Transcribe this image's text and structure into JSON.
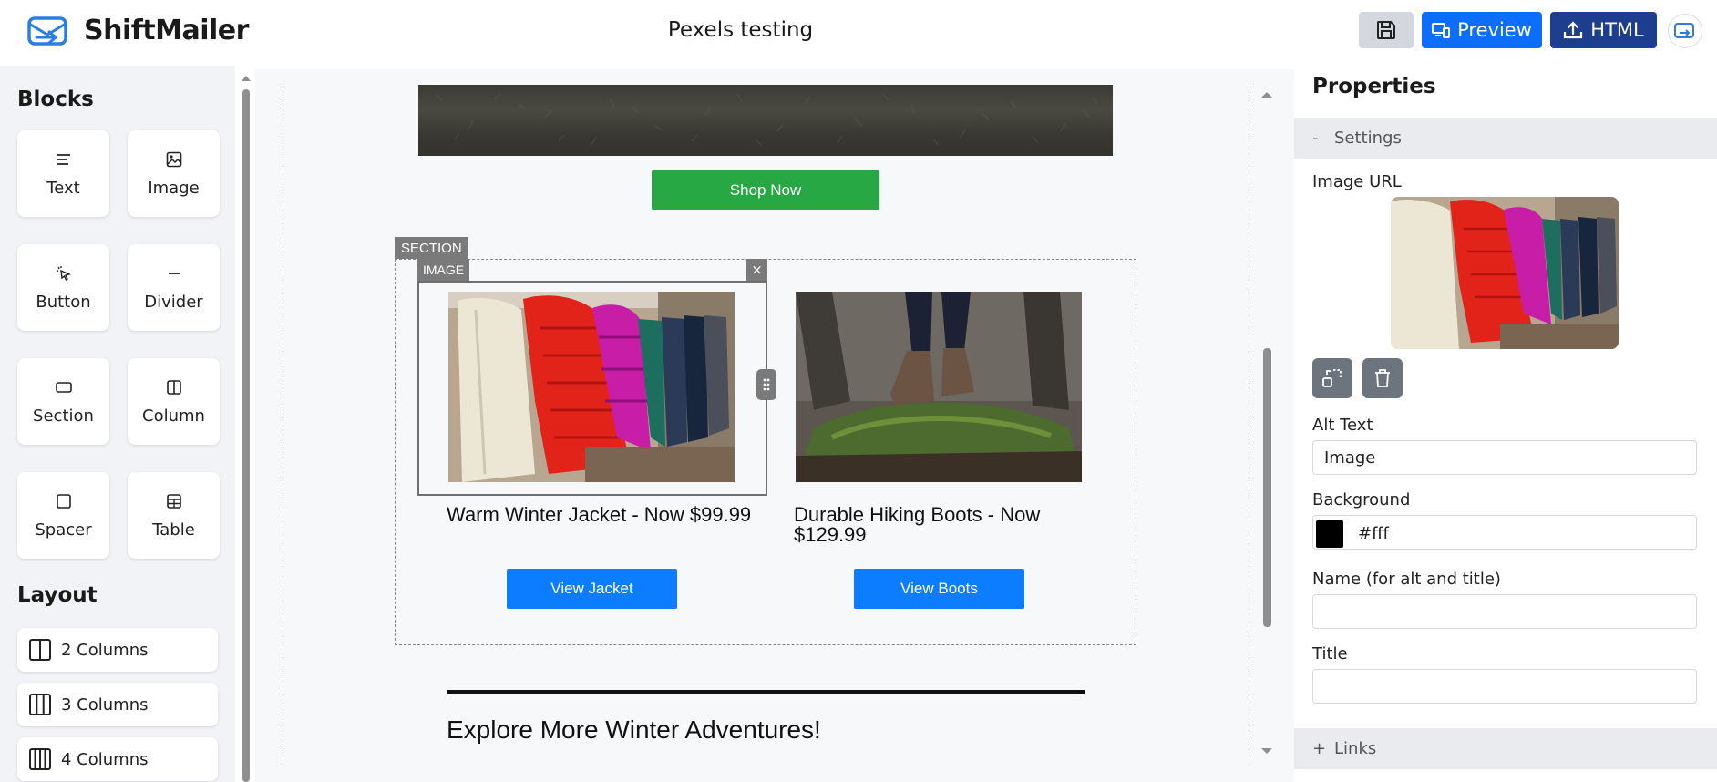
{
  "app": {
    "name": "ShiftMailer",
    "document_title": "Pexels testing"
  },
  "toolbar": {
    "save_icon": "floppy-disk-icon",
    "preview_label": "Preview",
    "html_label": "HTML"
  },
  "sidebar": {
    "blocks_heading": "Blocks",
    "blocks": [
      {
        "label": "Text",
        "icon": "text-lines-icon"
      },
      {
        "label": "Image",
        "icon": "image-icon"
      },
      {
        "label": "Button",
        "icon": "pointer-click-icon"
      },
      {
        "label": "Divider",
        "icon": "divider-icon"
      },
      {
        "label": "Section",
        "icon": "section-rect-icon"
      },
      {
        "label": "Column",
        "icon": "column-icon"
      },
      {
        "label": "Spacer",
        "icon": "spacer-square-icon"
      },
      {
        "label": "Table",
        "icon": "table-grid-icon"
      }
    ],
    "layout_heading": "Layout",
    "layouts": [
      {
        "label": "2 Columns"
      },
      {
        "label": "3 Columns"
      },
      {
        "label": "4 Columns"
      }
    ]
  },
  "canvas": {
    "shop_button": "Shop Now",
    "section_tag": "SECTION",
    "image_tag": "IMAGE",
    "close_glyph": "×",
    "products": [
      {
        "title": "Warm Winter Jacket - Now $99.99",
        "button": "View Jacket"
      },
      {
        "title": "Durable Hiking Boots - Now $129.99",
        "button": "View Boots"
      }
    ],
    "explore_heading": "Explore More Winter Adventures!",
    "colors": {
      "shop_button": "#28a745",
      "product_button": "#0d7dff"
    }
  },
  "properties": {
    "title": "Properties",
    "settings_section": {
      "sign": "-",
      "label": "Settings"
    },
    "image_url_label": "Image URL",
    "alt_text_label": "Alt Text",
    "alt_text_value": "Image",
    "background_label": "Background",
    "background_value": "#fff",
    "name_label": "Name (for alt and title)",
    "name_value": "",
    "title_label": "Title",
    "title_value": "",
    "links_section": {
      "sign": "+",
      "label": "Links"
    }
  },
  "theme": {
    "primary": "#0d6efd",
    "html_button": "#1d3d8f",
    "save_button": "#d4d8de"
  }
}
